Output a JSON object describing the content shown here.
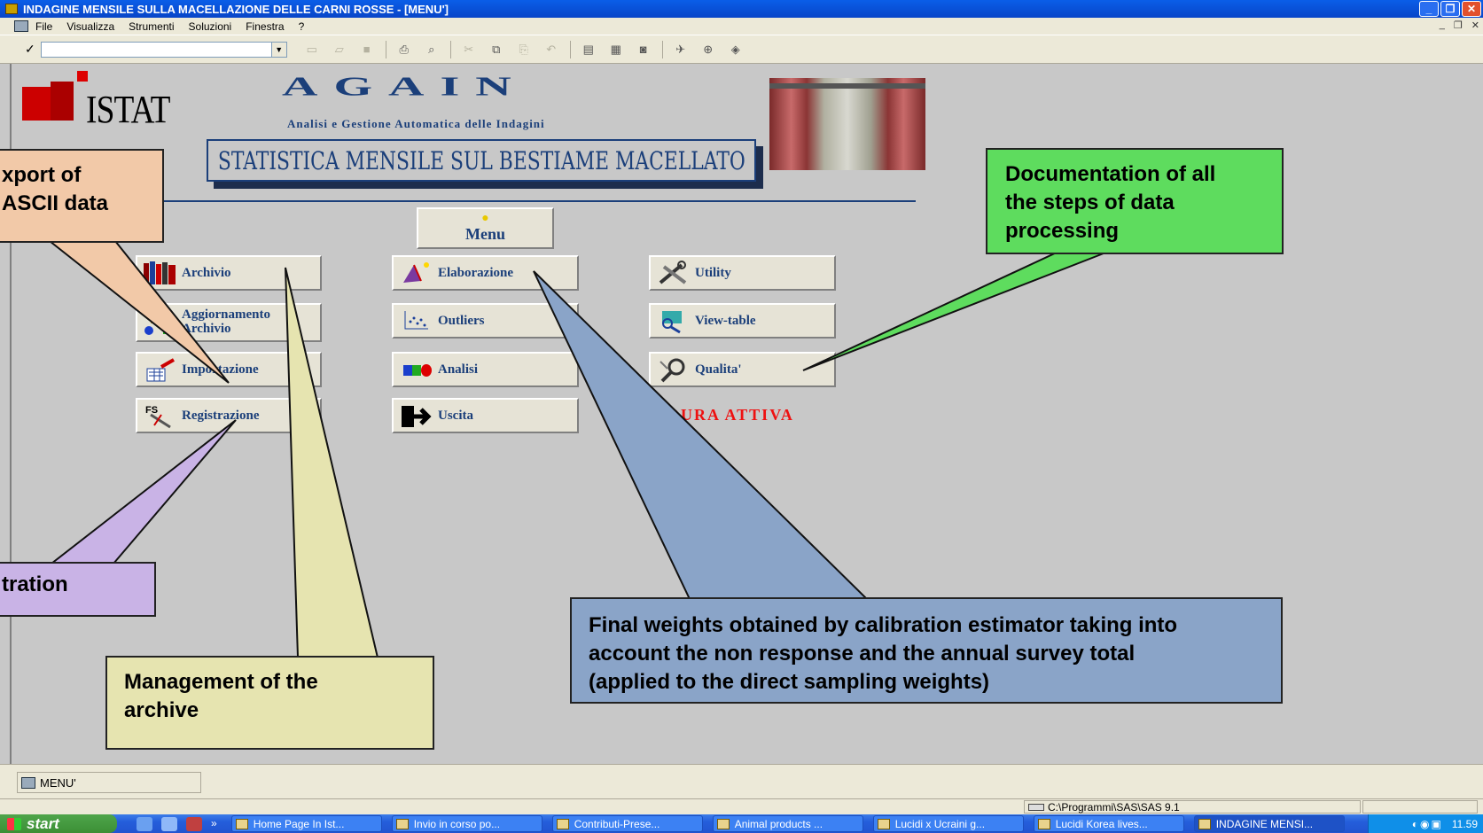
{
  "window": {
    "title": "INDAGINE MENSILE SULLA MACELLAZIONE DELLE CARNI ROSSE - [MENU']",
    "minimize": "_",
    "restore": "❐",
    "close": "✕"
  },
  "menubar": {
    "items": [
      "File",
      "Visualizza",
      "Strumenti",
      "Soluzioni",
      "Finestra",
      "?"
    ],
    "mdi_controls": [
      "_",
      "❐",
      "✕"
    ]
  },
  "toolbar": {
    "check_glyph": "✓",
    "command_value": "",
    "dropdown_glyph": "▼"
  },
  "header": {
    "istat_logo_text": "ISTAT",
    "again_title": "AGAIN",
    "again_subtitle": "Analisi e Gestione Automatica delle Indagini",
    "stat_title": "STATISTICA MENSILE SUL BESTIAME MACELLATO"
  },
  "menu_button": {
    "label": "Menu",
    "icon": "lightbulb-icon"
  },
  "buttons": {
    "archivio": "Archivio",
    "aggiornamento_l1": "Aggiornamento",
    "aggiornamento_l2": "Archivio",
    "importazione": "Importazione",
    "registrazione": "Registrazione",
    "elaborazione": "Elaborazione",
    "outliers": "Outliers",
    "analisi": "Analisi",
    "uscita": "Uscita",
    "utility": "Utility",
    "view_table": "View-table",
    "qualita": "Qualita'"
  },
  "procedura_attiva": "PROCEDURA   ATTIVA",
  "callouts": {
    "export": "xport of\n ASCII data",
    "registration": "tration",
    "management": "Management of  the\narchive",
    "documentation": "Documentation of all\nthe steps of data\nprocessing",
    "final_weights": "Final weights obtained by calibration estimator taking into\naccount the non  response and the annual survey total\n(applied to the direct sampling weights)"
  },
  "mdi_tab": "MENU'",
  "status": {
    "path": "C:\\Programmi\\SAS\\SAS 9.1"
  },
  "taskbar": {
    "start": "start",
    "quicklaunch_more": "»",
    "tasks": [
      "Home Page In Ist...",
      "Invio in corso po...",
      "Contributi-Prese...",
      "Animal products ...",
      "Lucidi x Ucraini g...",
      "Lucidi Korea lives...",
      "INDAGINE MENSI..."
    ],
    "clock": "11.59"
  },
  "colors": {
    "workspace": "#c8c8c8",
    "title_blue": "#1b3f7a",
    "callout_export": "#f2c9a8",
    "callout_registration": "#c9b3e6",
    "callout_management": "#e6e4b0",
    "callout_documentation": "#5edc5e",
    "callout_final_weights": "#8aa4c8",
    "procedura": "#ee1111"
  }
}
